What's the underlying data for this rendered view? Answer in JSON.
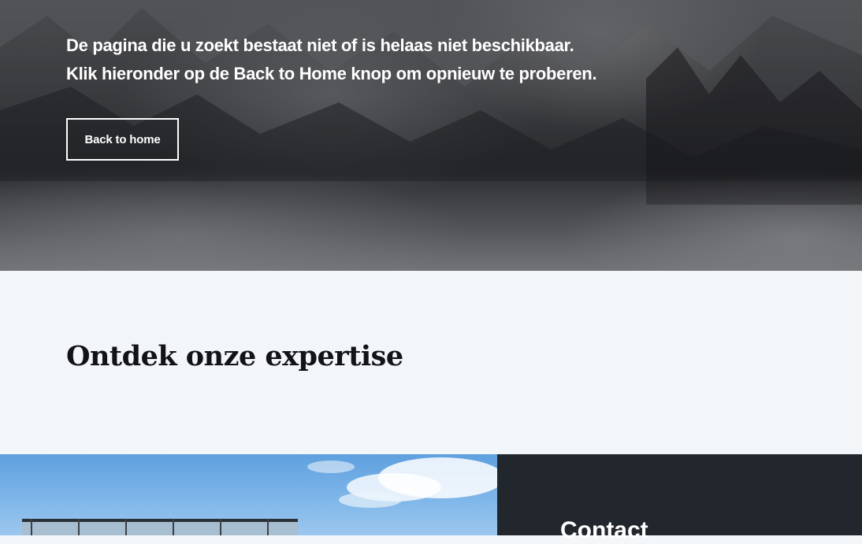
{
  "hero": {
    "line1": "De pagina die u zoekt bestaat niet of is helaas niet beschikbaar.",
    "line2": "Klik hieronder op de Back to Home knop om opnieuw te proberen.",
    "button_label": "Back to home"
  },
  "expertise": {
    "title": "Ontdek onze expertise"
  },
  "contact": {
    "title": "Contact"
  },
  "colors": {
    "hero_overlay": "#2b2c2f",
    "section_bg": "#f2f6f9",
    "contact_bg": "#22272e",
    "text_light": "#ffffff",
    "text_dark": "#111316"
  }
}
